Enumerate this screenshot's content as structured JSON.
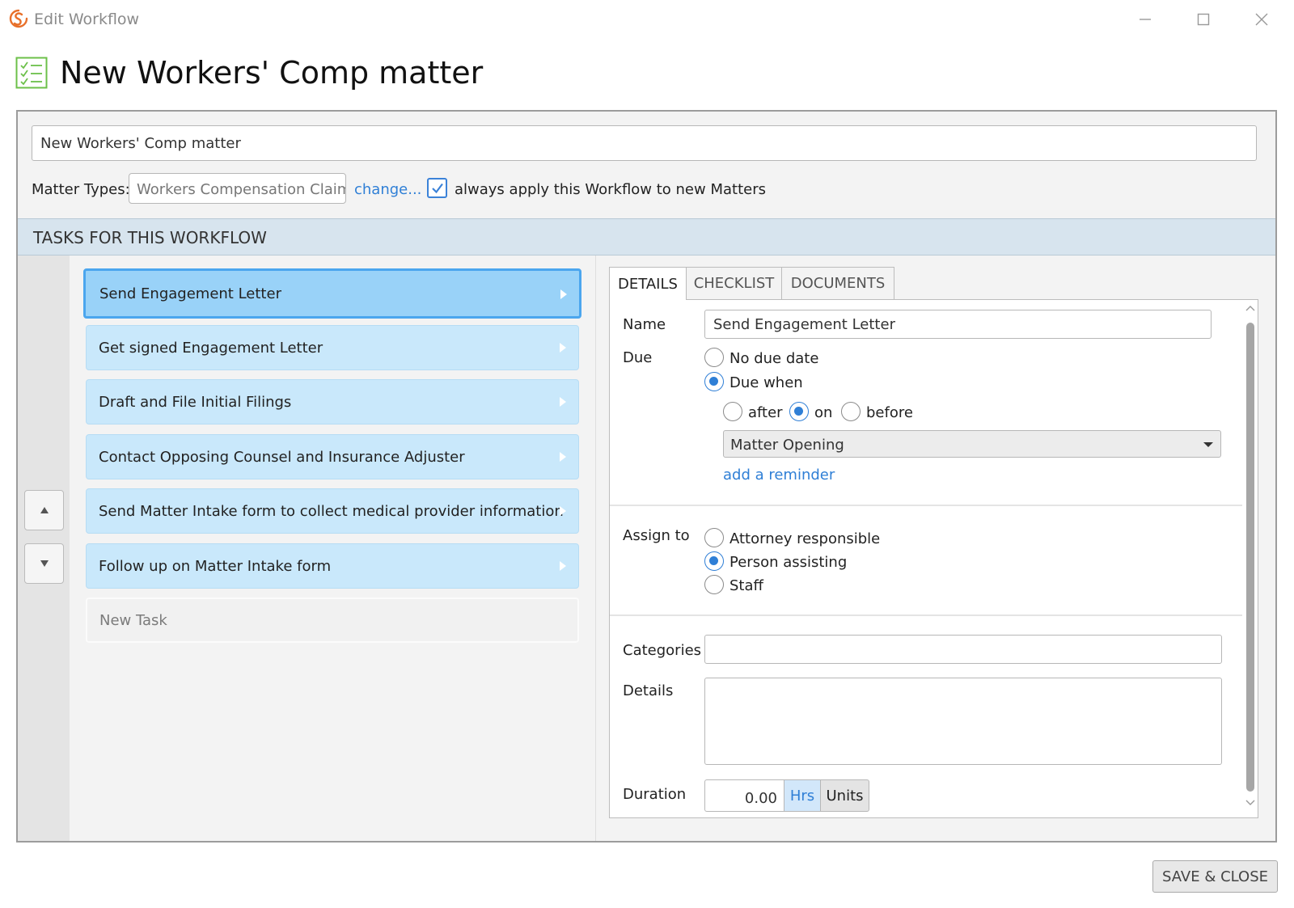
{
  "window": {
    "title": "Edit Workflow"
  },
  "page": {
    "title": "New Workers' Comp matter"
  },
  "workflow": {
    "name_value": "New Workers' Comp matter",
    "matter_types_label": "Matter Types:",
    "matter_type_value": "Workers Compensation Claim",
    "change_link": "change...",
    "always_apply_checked": true,
    "always_apply_label": "always apply this Workflow to new Matters"
  },
  "tasks": {
    "header": "TASKS FOR THIS WORKFLOW",
    "items": [
      {
        "label": "Send Engagement Letter",
        "selected": true
      },
      {
        "label": "Get signed Engagement Letter",
        "selected": false
      },
      {
        "label": "Draft and File Initial Filings",
        "selected": false
      },
      {
        "label": "Contact Opposing Counsel and Insurance Adjuster",
        "selected": false
      },
      {
        "label": "Send Matter Intake form to collect medical provider information",
        "selected": false
      },
      {
        "label": "Follow up on Matter Intake form",
        "selected": false
      }
    ],
    "new_task_placeholder": "New Task"
  },
  "detail_tabs": [
    {
      "label": "DETAILS",
      "active": true
    },
    {
      "label": "CHECKLIST",
      "active": false
    },
    {
      "label": "DOCUMENTS",
      "active": false
    }
  ],
  "details": {
    "name_label": "Name",
    "name_value": "Send Engagement Letter",
    "due_label": "Due",
    "due_options": {
      "no_due_date": "No due date",
      "due_when": "Due when"
    },
    "due_selected": "due_when",
    "relation_options": {
      "after": "after",
      "on": "on",
      "before": "before"
    },
    "relation_selected": "on",
    "anchor_value": "Matter Opening",
    "add_reminder": "add a reminder",
    "assign_label": "Assign to",
    "assign_options": {
      "attorney": "Attorney responsible",
      "person": "Person assisting",
      "staff": "Staff"
    },
    "assign_selected": "person",
    "categories_label": "Categories",
    "categories_value": "",
    "details_label": "Details",
    "details_value": "",
    "duration_label": "Duration",
    "duration_value": "0.00",
    "duration_unit_hrs": "Hrs",
    "duration_unit_units": "Units",
    "duration_unit_selected": "Hrs"
  },
  "footer": {
    "save_close": "SAVE & CLOSE"
  },
  "colors": {
    "accent": "#2f7fd6",
    "task_selected": "#99d2f8",
    "task_default": "#c9e8fb",
    "header_band": "#d7e4ee",
    "checklist_icon": "#6cc04a",
    "logo": "#e8702a"
  },
  "icons": {
    "app_logo": "sync-logo-icon",
    "page_icon": "checklist-icon",
    "minimize": "minimize-icon",
    "maximize": "maximize-icon",
    "close": "close-icon",
    "task_arrow": "chevron-right-icon",
    "move_up": "triangle-up-icon",
    "move_down": "triangle-down-icon",
    "dropdown": "caret-down-icon",
    "check": "checkmark-icon"
  }
}
